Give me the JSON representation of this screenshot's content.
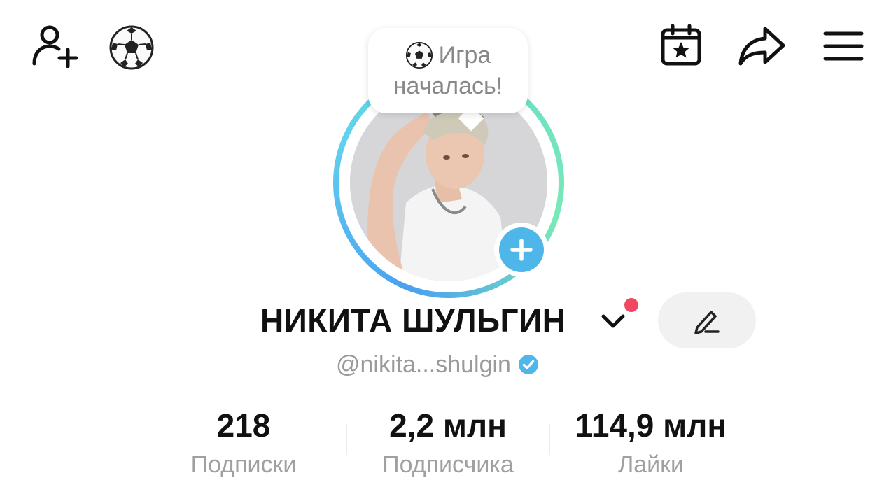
{
  "header": {
    "add_user_icon": "add-user-icon",
    "ball_icon": "soccer-ball-icon",
    "calendar_icon": "calendar-star-icon",
    "share_icon": "share-arrow-icon",
    "menu_icon": "hamburger-menu-icon"
  },
  "tooltip": {
    "line1": "Игра",
    "line2": "началась!",
    "ball_emoji": "⚽"
  },
  "profile": {
    "name": "НИКИТА ШУЛЬГИН",
    "handle": "@nikita...shulgin",
    "verified_color": "#4fb6ea",
    "ring_colors": [
      "#4aa0f0",
      "#7ae8b8"
    ]
  },
  "stats": [
    {
      "value": "218",
      "label": "Подписки"
    },
    {
      "value": "2,2 млн",
      "label": "Подписчика"
    },
    {
      "value": "114,9 млн",
      "label": "Лайки"
    }
  ]
}
